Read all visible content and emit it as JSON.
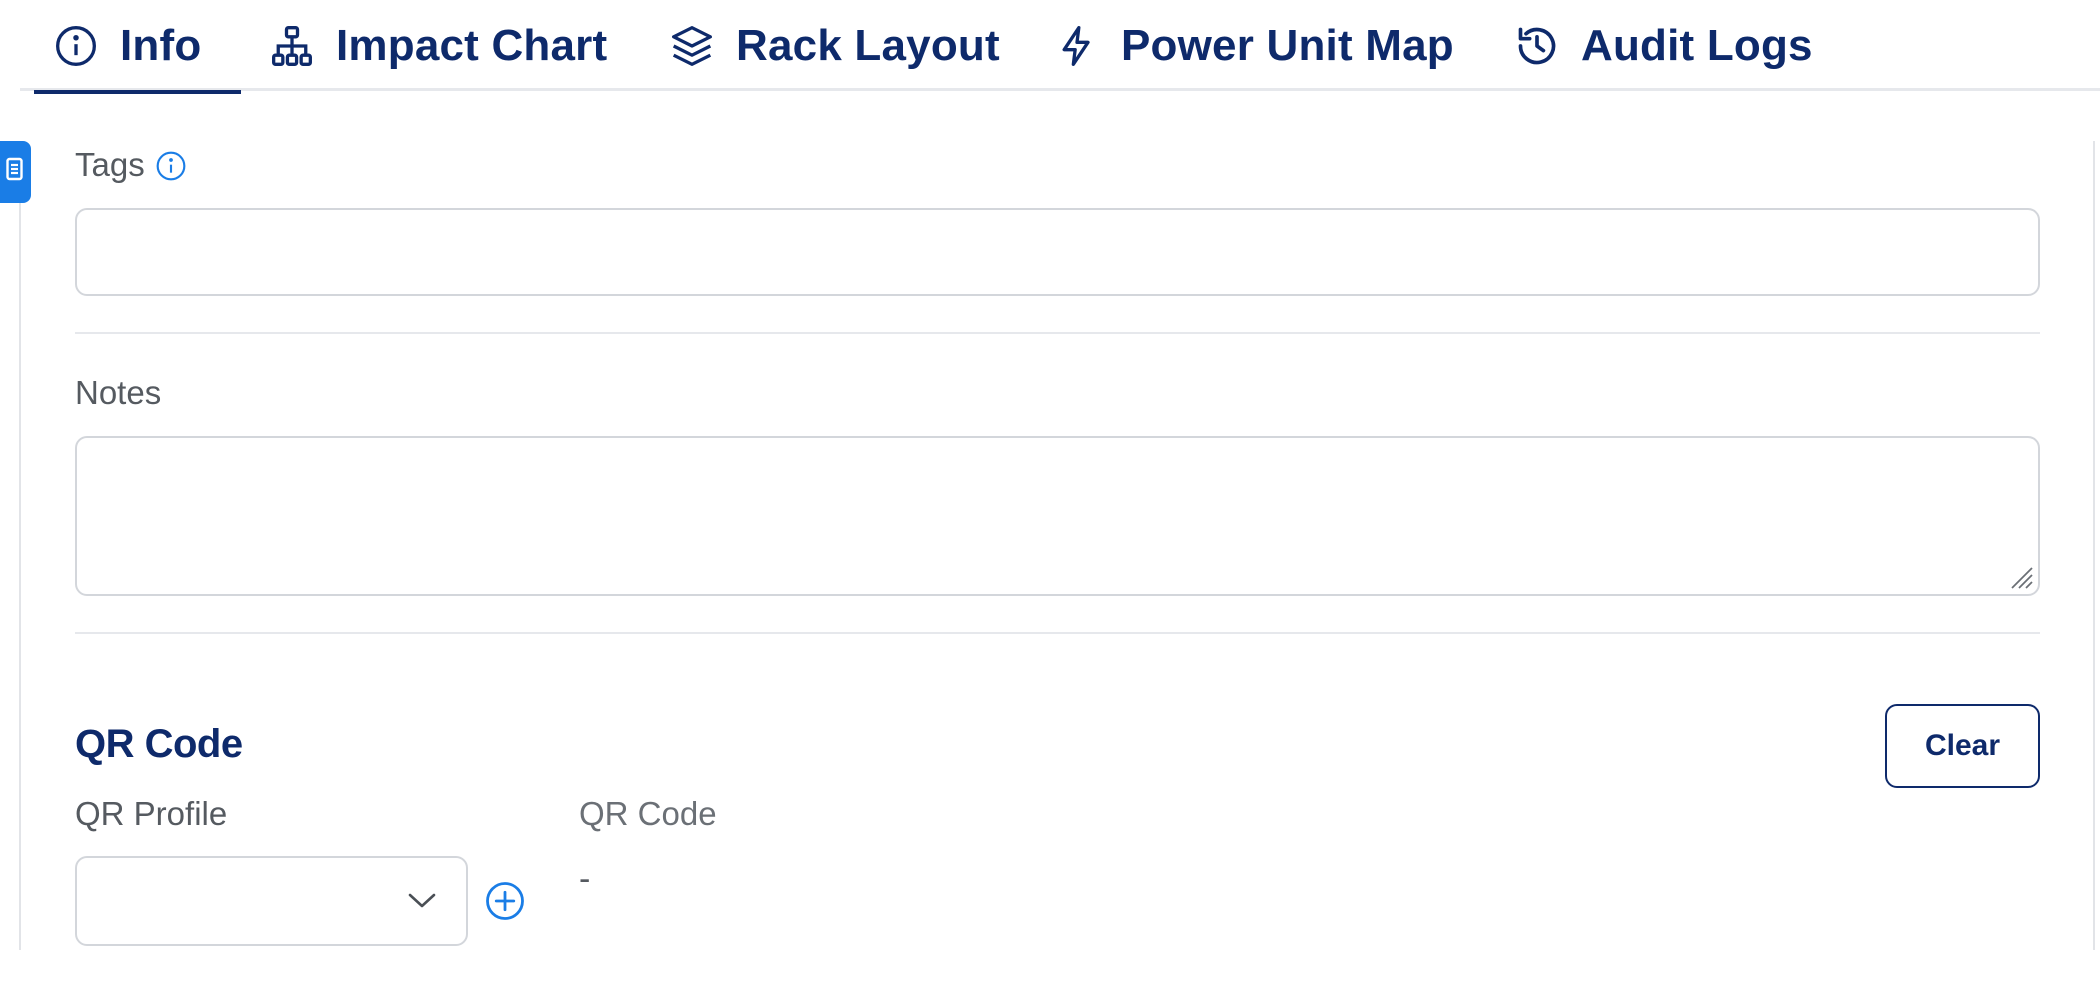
{
  "tabs": [
    {
      "label": "Info",
      "icon": "info-icon",
      "active": true
    },
    {
      "label": "Impact Chart",
      "icon": "hierarchy-icon",
      "active": false
    },
    {
      "label": "Rack Layout",
      "icon": "layers-icon",
      "active": false
    },
    {
      "label": "Power Unit Map",
      "icon": "lightning-icon",
      "active": false
    },
    {
      "label": "Audit Logs",
      "icon": "history-icon",
      "active": false
    }
  ],
  "form": {
    "tags_label": "Tags",
    "tags_value": "",
    "notes_label": "Notes",
    "notes_value": ""
  },
  "qr": {
    "section_title": "QR Code",
    "clear_label": "Clear",
    "profile_label": "QR Profile",
    "profile_value": "",
    "code_label": "QR Code",
    "code_value": "-"
  },
  "colors": {
    "brand_navy": "#0e2a6b",
    "accent_blue": "#1a7de6",
    "label_gray": "#555a60",
    "border_gray": "#d3d6db"
  }
}
